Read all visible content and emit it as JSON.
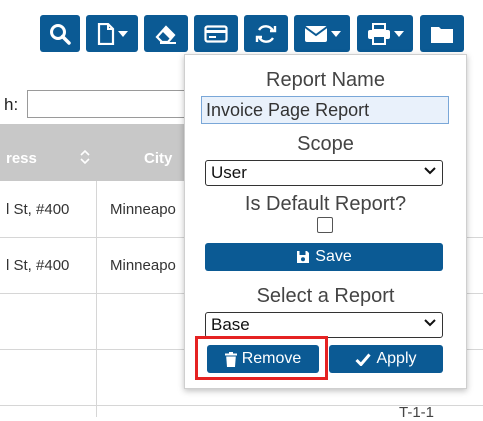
{
  "toolbar": {
    "buttons": [
      {
        "name": "search-icon"
      },
      {
        "name": "new-document-icon",
        "has_dropdown": true
      },
      {
        "name": "eraser-icon"
      },
      {
        "name": "card-icon"
      },
      {
        "name": "refresh-icon"
      },
      {
        "name": "envelope-icon",
        "has_dropdown": true
      },
      {
        "name": "printer-icon",
        "has_dropdown": true
      },
      {
        "name": "folder-icon"
      }
    ]
  },
  "search": {
    "label": "h:"
  },
  "grid": {
    "columns": [
      {
        "label": "ress"
      },
      {
        "label": "City"
      }
    ],
    "rows": [
      {
        "address": "l St, #400",
        "city": "Minneapo"
      },
      {
        "address": "l St, #400",
        "city": "Minneapo"
      },
      {
        "address": "",
        "city": ""
      },
      {
        "address": "",
        "city": ""
      }
    ],
    "footer_text": "T-1-1"
  },
  "report_panel": {
    "report_name_label": "Report Name",
    "report_name_value": "Invoice Page Report",
    "scope_label": "Scope",
    "scope_value": "User",
    "default_label": "Is Default Report?",
    "default_checked": false,
    "save_label": "Save",
    "select_label": "Select a Report",
    "select_value": "Base",
    "remove_label": "Remove",
    "apply_label": "Apply"
  },
  "colors": {
    "primary_blue": "#0b5a94",
    "highlight_red": "#e52222",
    "header_gray": "#c8c8c8"
  }
}
